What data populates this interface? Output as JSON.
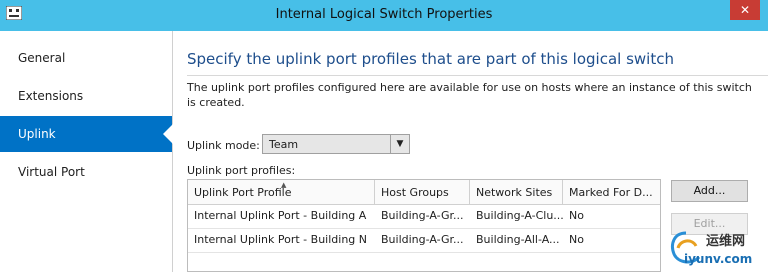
{
  "window": {
    "title": "Internal Logical Switch Properties",
    "close_glyph": "✕"
  },
  "sidebar": {
    "items": [
      {
        "label": "General",
        "active": false
      },
      {
        "label": "Extensions",
        "active": false
      },
      {
        "label": "Uplink",
        "active": true
      },
      {
        "label": "Virtual Port",
        "active": false
      }
    ]
  },
  "main": {
    "heading": "Specify the uplink port profiles that are part of this logical switch",
    "description": "The uplink port profiles configured here are available for use on hosts where an instance of this switch is created.",
    "uplink_mode": {
      "label": "Uplink mode:",
      "value": "Team"
    },
    "profiles_label": "Uplink port profiles:",
    "table": {
      "columns": [
        "Uplink Port Profile",
        "Host Groups",
        "Network Sites",
        "Marked For D..."
      ],
      "rows": [
        [
          "Internal Uplink Port - Building A",
          "Building-A-Gr...",
          "Building-A-Clu...",
          "No"
        ],
        [
          "Internal Uplink Port - Building N",
          "Building-A-Gr...",
          "Building-All-A...",
          "No"
        ]
      ]
    },
    "buttons": {
      "add": "Add...",
      "edit": "Edit..."
    }
  },
  "watermark": {
    "text1": "运维网",
    "text2": "iyunv.com"
  },
  "colors": {
    "titlebar": "#47bfe8",
    "accent": "#0072c6",
    "heading": "#1e4e8c",
    "close": "#c83c34"
  }
}
